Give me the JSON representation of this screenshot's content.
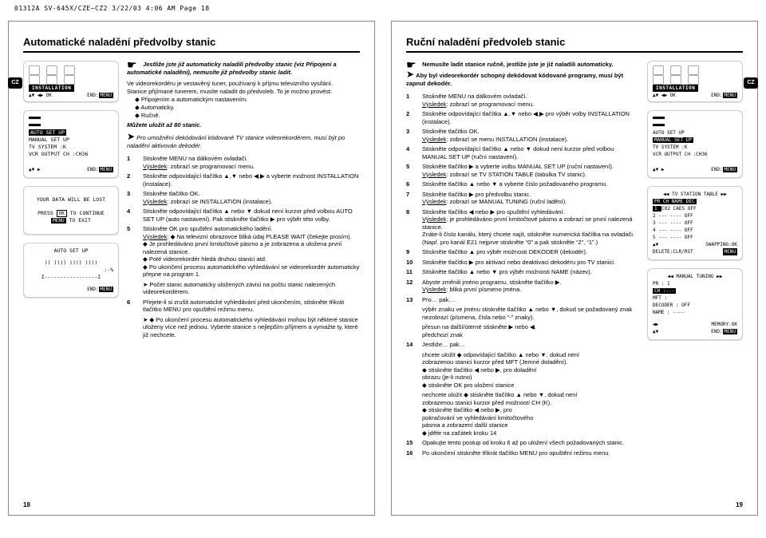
{
  "runner": "01312A SV-645X/CZE~CZ2  3/22/03 4:06 AM  Page 18",
  "lang_tab": "CZ",
  "page_numbers": {
    "left": "18",
    "right": "19"
  },
  "left": {
    "title": "Automatické naladění předvolby stanic",
    "intro1": "Jestliže jste již automaticky naladili předvolby stanic (viz Připojení a automatické naladění), nemusíte již předvolby stanic ladit.",
    "intro2": "Ve videorekordéru je vestavěný tuner, používaný k příjmu televizního vysílání.",
    "intro3": "Stanice přijímané tunerem, musíte naladit do předvoleb. To je možno provést:",
    "methods": [
      "Připojením a automatickým nastavením.",
      "Automaticky.",
      "Ručně."
    ],
    "capacity": "Můžete uložit až 80 stanic.",
    "enable_note": "Pro umožnění dekódování kódované TV stanice videorekordérem, musí být po naladění aktivován dekodér.",
    "steps": [
      {
        "n": "1",
        "t": "Stiskněte MENU na dálkovém ovladači.",
        "r": "Výsledek: zobrazí se programovací menu."
      },
      {
        "n": "2",
        "t": "Stiskněte odpovídající tlačítka ▲,▼ nebo ◀,▶ a vyberte možnost INSTALLATION (instalace)."
      },
      {
        "n": "3",
        "t": "Stiskněte tlačítko OK.",
        "r": "Výsledek: zobrazí se INSTALLATION (instalace)."
      },
      {
        "n": "4",
        "t": "Stiskněte odpovídající tlačítka ▲ nebo ▼ dokud není kurzor před volbou AUTO SET UP (auto nastavení). Pak stiskněte tlačítko ▶ pro výběr této volby."
      },
      {
        "n": "5",
        "t": "Stiskněte OK pro spuštění automatického ladění.",
        "r": "Výsledek: ◆ Na televizní obrazovce bliká údaj PLEASE WAIT (čekejte prosím).\n◆ Je prohledáváno první kmitočtové pásmo a je zobrazena a uložena první nalezená stanice.\n◆ Poté videorekordér hledá druhou stanici atd.\n◆ Po ukončení procesu automatického vyhledávání se videorekordér automaticky přepne na program 1."
      },
      {
        "n": "",
        "t": "➤ Počet stanic automaticky uložených závisí na počtu stanic nalezených videorekordérem."
      },
      {
        "n": "6",
        "t": "Přejete-li si zrušit automatické vyhledávání před ukončením, stiskněte třikrát tlačítko MENU pro opuštění režimu menu."
      },
      {
        "n": "",
        "t": "➤ ◆ Po ukončení procesu automatického vyhledávání mohou být některé stanice uloženy více než jednou. Vyberte stanice s nejlepším příjmem a vymažte ty, které již nechcete."
      }
    ],
    "osd": {
      "install": "INSTALLATION",
      "nav_arrows": "▲▼ ◀▶ OK",
      "nav_end": "END:",
      "menu_btn": "MENU",
      "auto_setup": "AUTO SET UP",
      "manual_setup": "MANUAL SET UP",
      "tv_system": "TV SYSTEM     :K",
      "vcr_out": "VCR OUTPUT CH :CH36",
      "nav2": "▲▼ ▶",
      "data_lost": "YOUR DATA WILL BE LOST",
      "press_ok": "PRESS",
      "ok": "OK",
      "to_continue": "TO CONTINUE",
      "press_menu": "MENU",
      "to_exit": "TO EXIT",
      "progress_title": "AUTO SET UP",
      "progress_bars": ")) ))))  ))))  ))))",
      "progress_pct": ":-%",
      "progress_bar": "I-----------------I"
    }
  },
  "right": {
    "title": "Ruční naladění předvoleb stanic",
    "note_hand": "Nemusíte ladit stanice ručně, jestliže jste je již naladili automaticky.",
    "note_arrow": "Aby byl videorekordér schopný dekódovat kódované programy, musí být zapnut dekodér.",
    "steps": [
      {
        "n": "1",
        "t": "Stiskněte MENU na dálkovém ovladači.",
        "r": "Výsledek: zobrazí se programovací menu."
      },
      {
        "n": "2",
        "t": "Stiskněte odpovídající tlačítka ▲,▼ nebo ◀,▶ pro výběr volby INSTALLATION (instalace)."
      },
      {
        "n": "3",
        "t": "Stiskněte tlačítko OK.",
        "r": "Výsledek: zobrazí se menu INSTALLATION (instalace)."
      },
      {
        "n": "4",
        "t": "Stiskněte odpovídající tlačítko ▲ nebo ▼ dokud není kurzor před volbou MANUAL SET UP (ruční nastavení)."
      },
      {
        "n": "5",
        "t": "Stiskněte tlačítko ▶ a vyberte volbu MANUAL SET UP (ruční nastavení).",
        "r": "Výsledek: zobrazí se TV STATION TABLE (tabulka TV stanic)."
      },
      {
        "n": "6",
        "t": "Stiskněte tlačítko ▲ nebo ▼ a vyberte číslo požadovaného programu."
      },
      {
        "n": "7",
        "t": "Stiskněte tlačítko ▶ pro předvolbu stanic.",
        "r": "Výsledek: zobrazí se MANUAL TUNING (ruční ladění)."
      },
      {
        "n": "8",
        "t": "Stiskněte tlačítko ◀ nebo ▶ pro spuštění vyhledávání.",
        "r": "Výsledek: je prohledáváno první kmitočtové pásmo a zobrazí se první nalezená stanice.\nZnáte-li číslo kanálu, který chcete najít, stiskněte numerická tlačítka na ovladači. (Např. pro kanál E21 nejprve stiskněte “0” a pak stiskněte “2”, “1”.)"
      },
      {
        "n": "9",
        "t": "Stiskněte tlačítko ▲ pro výběr možnosti DEKODER (dekodér)."
      },
      {
        "n": "10",
        "t": "Stiskněte tlačítko ▶ pro aktivaci nebo deaktivaci dekodéru pro TV stanici."
      },
      {
        "n": "11",
        "t": "Stiskněte tlačítko ▲ nebo ▼ pro výběr možnosti NAME (název)."
      },
      {
        "n": "12",
        "t": "Abyste změnili jméno programu, stiskněte tlačítko ▶.",
        "r": "Výsledek: bliká první písmeno jména."
      },
      {
        "n": "13",
        "t": "Pro…                       pak…"
      },
      {
        "n": "",
        "t": "výběr znaku ve jménu    stiskněte tlačítko ▲ nebo ▼, dokud se požadovaný znak nezobrazí (písmena, čísla nebo “-” znaky)."
      },
      {
        "n": "",
        "t": "přesun na další/úterné    stiskněte ▶ nebo ◀.\npředchozí znak"
      },
      {
        "n": "14",
        "t": "Jestliže…                   pak…"
      },
      {
        "n": "",
        "t": "chcete uložit       ◆ odpovídající tlačítko ▲ nebo ▼, dokud není\nzobrazenou stanici    kurzor před MFT (Jemné doladění).\n                    ◆ stiskněte tlačítko ◀ nebo ▶, pro doladění\n                      obrazu (je-li nutno)\n                    ◆ stiskněte OK pro uložení stanice"
      },
      {
        "n": "",
        "t": "nechcete uložit    ◆ stiskněte tlačítko ▲ nebo ▼, dokud není\nzobrazenou stanici   kurzor před možností CH (K).\n                    ◆ stiskněte tlačítko ◀ nebo ▶, pro\n                      pokračování ve vyhledávání kmitočtového\n                      pásma a zobrazení další stanice\n                    ◆ jděte na začátek kroku 14"
      },
      {
        "n": "15",
        "t": "Opakujte tento postup od kroku 6 až po uložení všech požadovaných stanic."
      },
      {
        "n": "16",
        "t": "Po ukončení stiskněte třikrát tlačítko MENU pro opuštění režimu menu."
      }
    ],
    "osd": {
      "install": "INSTALLATION",
      "nav_arrows": "▲▼ ◀▶ OK",
      "nav_end": "END:",
      "menu_btn": "MENU",
      "auto_setup": "AUTO SET UP",
      "manual_setup": "MANUAL SET UP",
      "tv_system": "TV SYSTEM     :K",
      "vcr_out": "VCR OUTPUT CH :CH36",
      "nav2": "▲▼ ▶",
      "tv_table_title": "◀◀ TV STATION TABLE ▶▶",
      "tv_table_header": "PR   CH   NAME   DEC",
      "tv_table_rows": [
        " 1  C02  CAES   OFF",
        " 2  ---  ----   OFF",
        " 3  ---  ----   OFF",
        " 4  ---  ----   OFF",
        " 5  ---  ----   OFF"
      ],
      "tv_table_nav1": "▲▼",
      "tv_table_swap": "SWAPPING:OK",
      "tv_table_nav2": "DELETE:CLR/RST",
      "manual_tuning_title": "◀◀ MANUAL TUNING ▶▶",
      "mt_pr": "PR         : 1",
      "mt_ch": "CH         :---",
      "mt_mft": "MFT        :",
      "mt_decoder": "DECODER    : OFF",
      "mt_name": "NAME       : ----",
      "mt_nav1": "◀▶",
      "mt_nav2": "▲▼",
      "mt_memory": "MEMORY:OK",
      "mt_end": "END:"
    }
  }
}
